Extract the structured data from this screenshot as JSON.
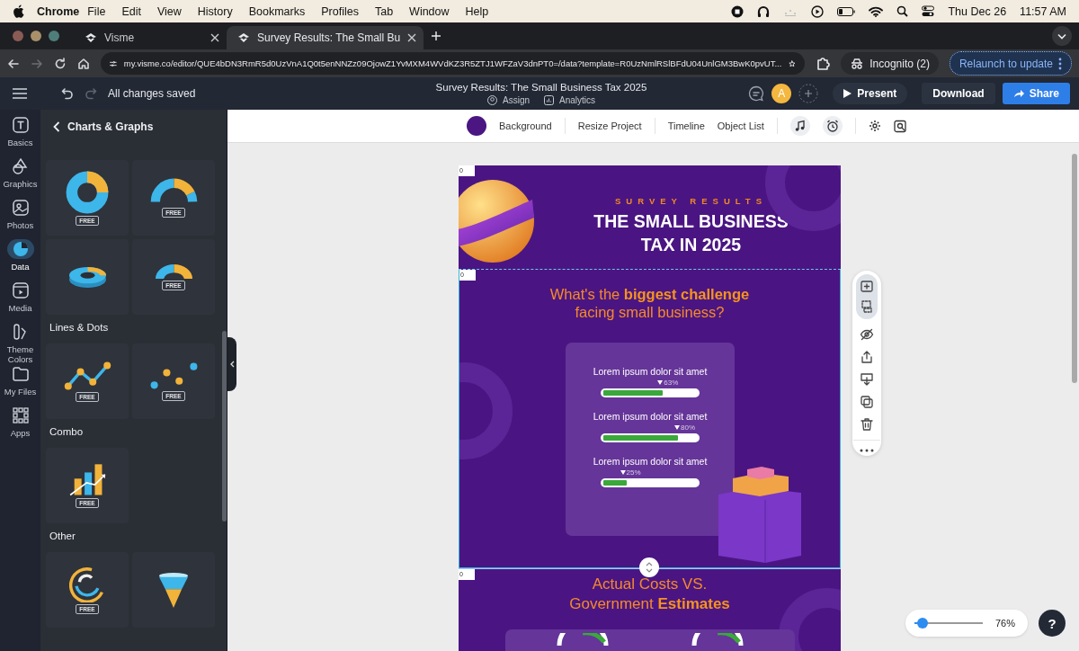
{
  "menubar": {
    "app": "Chrome",
    "menus": [
      "File",
      "Edit",
      "View",
      "History",
      "Bookmarks",
      "Profiles",
      "Tab",
      "Window",
      "Help"
    ],
    "date": "Thu Dec 26",
    "time": "11:57 AM"
  },
  "browser": {
    "tabs": [
      {
        "title": "Visme",
        "selected": false
      },
      {
        "title": "Survey Results: The Small Bu",
        "selected": true
      }
    ],
    "nav": [
      {
        "kind": "back",
        "disabled": false
      },
      {
        "kind": "forward",
        "disabled": true
      },
      {
        "kind": "reload",
        "disabled": false
      },
      {
        "kind": "home",
        "disabled": false
      }
    ],
    "url": "my.visme.co/editor/QUE4bDN3RmR5d0UzVnA1Q0t5enNNZz09OjowZ1YvMXM4WVdKZ3R5ZTJ1WFZaV3dnPT0=/data?template=R0UzNmlRSlBFdU04UnlGM3BwK0pvUT...",
    "incognito": "Incognito (2)",
    "relaunch": "Relaunch to update"
  },
  "editor": {
    "undo": {
      "disabled": false
    },
    "redo": {
      "disabled": true
    },
    "save_status": "All changes saved",
    "title": "Survey Results: The Small Business Tax 2025",
    "assign": "Assign",
    "analytics": "Analytics",
    "avatar": "A",
    "present": "Present",
    "download": "Download",
    "share": "Share"
  },
  "rail": [
    {
      "label": "Basics",
      "selected": false
    },
    {
      "label": "Graphics",
      "selected": false
    },
    {
      "label": "Photos",
      "selected": false
    },
    {
      "label": "Data",
      "selected": true
    },
    {
      "label": "Media",
      "selected": false
    },
    {
      "label": "Theme Colors",
      "selected": false
    },
    {
      "label": "My Files",
      "selected": false
    },
    {
      "label": "Apps",
      "selected": false
    }
  ],
  "panel": {
    "title": "Charts & Graphs",
    "sections": [
      {
        "items": [
          {
            "kind": "donut",
            "badge": "FREE"
          },
          {
            "kind": "half-donut",
            "badge": "FREE"
          },
          {
            "kind": "donut-3d"
          },
          {
            "kind": "half-donut-3d",
            "badge": "FREE"
          }
        ]
      },
      {
        "heading": "Lines & Dots",
        "items": [
          {
            "kind": "line",
            "badge": "FREE"
          },
          {
            "kind": "scatter",
            "badge": "FREE"
          }
        ]
      },
      {
        "heading": "Combo",
        "items": [
          {
            "kind": "combo",
            "badge": "FREE"
          }
        ]
      },
      {
        "heading": "Other",
        "items": [
          {
            "kind": "radial",
            "badge": "FREE"
          },
          {
            "kind": "funnel"
          }
        ]
      }
    ]
  },
  "toolbar": [
    "Background",
    "Resize Project",
    "Timeline",
    "Object List"
  ],
  "page": {
    "markers": [
      "0",
      "0",
      "0"
    ],
    "eyebrow": "SURVEY RESULTS",
    "title": "THE SMALL BUSINESS TAX IN 2025",
    "question": "What's the **biggest challenge** facing small business?",
    "bars": [
      {
        "label": "Lorem ipsum dolor sit amet",
        "level": 0.63,
        "reading": "63%"
      },
      {
        "label": "Lorem ipsum dolor sit amet",
        "level": 0.8,
        "reading": "80%"
      },
      {
        "label": "Lorem ipsum dolor sit amet",
        "level": 0.25,
        "reading": "25%"
      }
    ],
    "section_title": "Actual Costs VS. Government **Estimates**"
  },
  "zoom": {
    "level": 0.12,
    "reading": "76%"
  },
  "help": "?"
}
